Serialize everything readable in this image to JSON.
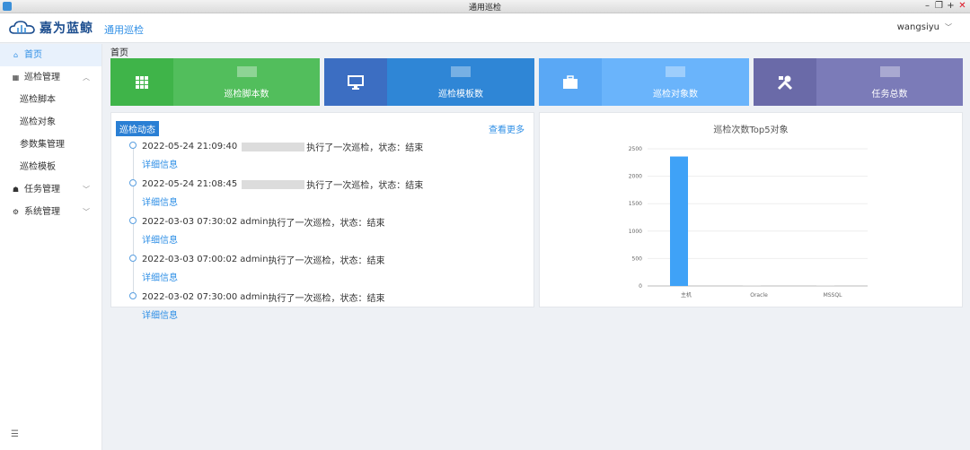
{
  "window": {
    "title": "通用巡检"
  },
  "header": {
    "brand": "嘉为蓝鲸",
    "app_name": "通用巡检",
    "username": "wangsiyu"
  },
  "sidebar": {
    "items": [
      {
        "label": "首页",
        "icon": "home-icon",
        "active": true
      },
      {
        "label": "巡检管理",
        "icon": "grid-icon",
        "expanded": true,
        "children": [
          "巡检脚本",
          "巡检对象",
          "参数集管理",
          "巡检模板"
        ]
      },
      {
        "label": "任务管理",
        "icon": "house-icon",
        "expanded": false
      },
      {
        "label": "系统管理",
        "icon": "gear-icon",
        "expanded": false
      }
    ]
  },
  "breadcrumb": "首页",
  "stats": [
    {
      "label": "巡检脚本数",
      "icon": "grid-dots-icon",
      "color_dark": "#3fb449",
      "color_light": "#52be5c"
    },
    {
      "label": "巡检模板数",
      "icon": "monitor-icon",
      "color_dark": "#3c6ec2",
      "color_light": "#2f86d6"
    },
    {
      "label": "巡检对象数",
      "icon": "briefcase-icon",
      "color_dark": "#5aa8f5",
      "color_light": "#6ab4fb"
    },
    {
      "label": "任务总数",
      "icon": "tools-icon",
      "color_dark": "#6a6aa8",
      "color_light": "#7b7bb8"
    }
  ],
  "feed": {
    "title": "巡检动态",
    "more": "查看更多",
    "detail_label": "详细信息",
    "items": [
      {
        "time": "2022-05-24 21:09:40",
        "user": "",
        "text": "执行了一次巡检，状态：结束"
      },
      {
        "time": "2022-05-24 21:08:45",
        "user": "",
        "text": "执行了一次巡检，状态：结束"
      },
      {
        "time": "2022-03-03 07:30:02",
        "user": "admin",
        "text": "执行了一次巡检，状态：结束"
      },
      {
        "time": "2022-03-03 07:00:02",
        "user": "admin",
        "text": "执行了一次巡检，状态：结束"
      },
      {
        "time": "2022-03-02 07:30:00",
        "user": "admin",
        "text": "执行了一次巡检，状态：结束"
      }
    ]
  },
  "chart_data": {
    "type": "bar",
    "title": "巡检次数Top5对象",
    "categories": [
      "主机",
      "Oracle",
      "MSSQL"
    ],
    "values": [
      2360,
      0,
      0
    ],
    "ylim": [
      0,
      2500
    ],
    "yticks": [
      0,
      500,
      1000,
      1500,
      2000,
      2500
    ],
    "bar_color": "#3fa2f7",
    "grid": true
  }
}
